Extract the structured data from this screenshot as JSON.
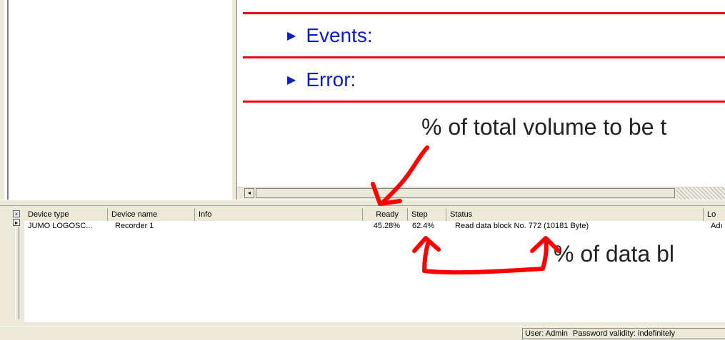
{
  "content": {
    "sections": [
      {
        "label": "Events:"
      },
      {
        "label": "Error:"
      }
    ],
    "annotation_top": "% of total volume to be t"
  },
  "scroll": {
    "left_arrow": "◂"
  },
  "list": {
    "side_buttons": {
      "close": "×",
      "expand": "▸"
    },
    "columns": [
      "Device type",
      "Device name",
      "Info",
      "Ready",
      "Step",
      "Status",
      "Lo"
    ],
    "rows": [
      {
        "device_type": "JUMO LOGOSC...",
        "device_name": "Recorder 1",
        "info": "",
        "ready": "45.28%",
        "step": "62.4%",
        "status": "Read data block No. 772 (10181 Byte)",
        "lo": "Adı"
      }
    ]
  },
  "annotation_bottom": "% of data bl",
  "statusbar": {
    "user": "User: Admin",
    "password": "Password validity: indefinitely"
  },
  "colors": {
    "annotation_arrow": "#ff0000",
    "section_text": "#0a1ad0",
    "divider": "#e01010"
  }
}
